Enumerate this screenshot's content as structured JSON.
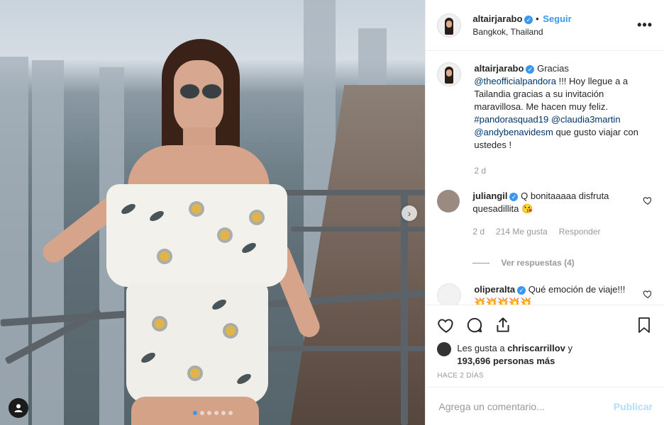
{
  "header": {
    "username": "altairjarabo",
    "follow_label": "Seguir",
    "location": "Bangkok, Thailand",
    "more_label": "•••"
  },
  "caption": {
    "username": "altairjarabo",
    "text_1": "Gracias",
    "mention_pandora": "@theofficialpandora",
    "text_2": "!!! Hoy llegue a a Tailandia gracias a su invitación maravillosa. Me hacen muy feliz.",
    "hashtag": "#pandorasquad19",
    "mention_claudia": "@claudia3martin",
    "mention_andy": "@andybenavidesm",
    "text_3": "que gusto viajar con ustedes !",
    "age": "2 d"
  },
  "comments": [
    {
      "username": "juliangil",
      "text": "Q bonitaaaaa disfruta quesadillita 😘",
      "age": "2 d",
      "likes": "214 Me gusta",
      "reply_label": "Responder",
      "view_replies": "Ver respuestas (4)"
    },
    {
      "username": "oliperalta",
      "text": "Qué emoción de viaje!!! 💥💥💥💥💥"
    }
  ],
  "likes": {
    "prefix": "Les gusta a",
    "user": "chriscarrillov",
    "middle": "y",
    "count": "193,696 personas más"
  },
  "timestamp": "HACE 2 DÍAS",
  "add_comment": {
    "placeholder": "Agrega un comentario...",
    "publish_label": "Publicar"
  },
  "carousel": {
    "total": 6,
    "active_index": 0,
    "next_label": "›"
  },
  "colors": {
    "accent": "#3897f0",
    "link": "#003569",
    "muted": "#999999"
  }
}
